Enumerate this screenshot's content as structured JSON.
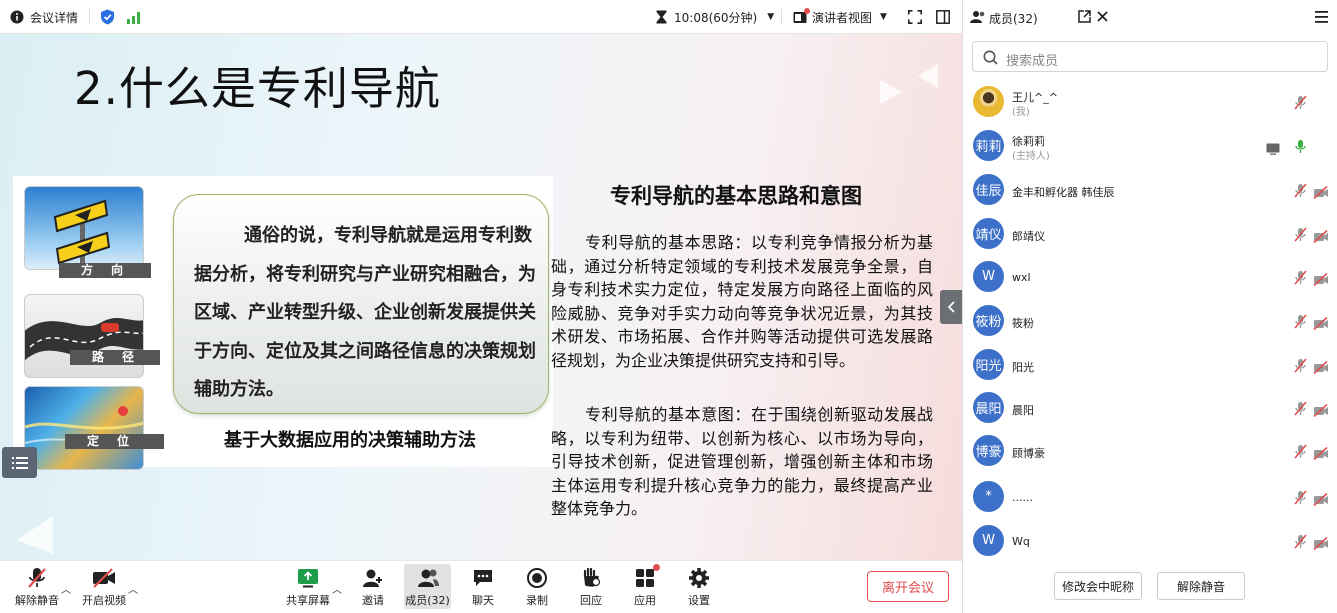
{
  "topbar": {
    "meeting_info": "会议详情",
    "timer": "10:08(60分钟)",
    "view_mode": "演讲者视图"
  },
  "slide": {
    "title": "2.什么是专利导航",
    "thumb_labels": [
      "方向",
      "路径",
      "定位"
    ],
    "bubble_text": "通俗的说，专利导航就是运用专利数据分析，将专利研究与产业研究相融合，为区域、产业转型升级、企业创新发展提供关于方向、定位及其之间路径信息的决策规划辅助方法。",
    "caption": "基于大数据应用的决策辅助方法",
    "right_title": "专利导航的基本思路和意图",
    "para1": "专利导航的基本思路：以专利竞争情报分析为基础，通过分析特定领域的专利技术发展竞争全景，自身专利技术实力定位，特定发展方向路径上面临的风险威胁、竞争对手实力动向等竞争状况近景，为其技术研发、市场拓展、合作并购等活动提供可选发展路径规划，为企业决策提供研究支持和引导。",
    "para2": "专利导航的基本意图：在于围绕创新驱动发展战略，以专利为纽带、以创新为核心、以市场为导向，引导技术创新，促进管理创新，增强创新主体和市场主体运用专利提升核心竞争力的能力，最终提高产业整体竞争力。"
  },
  "panel": {
    "title": "成员(32)",
    "search_placeholder": "搜索成员",
    "members": [
      {
        "avatar": "",
        "name": "王儿^_^",
        "sub": "(我)",
        "mic": "muted",
        "cam": "none"
      },
      {
        "avatar": "莉莉",
        "name": "徐莉莉",
        "sub": "(主持人)",
        "mic": "on",
        "cam": "screen"
      },
      {
        "avatar": "佳辰",
        "name": "金丰和孵化器 韩佳辰",
        "sub": "",
        "mic": "muted",
        "cam": "off"
      },
      {
        "avatar": "靖仪",
        "name": "郎靖仪",
        "sub": "",
        "mic": "muted",
        "cam": "off"
      },
      {
        "avatar": "W",
        "name": "wxl",
        "sub": "",
        "mic": "muted",
        "cam": "off"
      },
      {
        "avatar": "筱粉",
        "name": "筱粉",
        "sub": "",
        "mic": "muted",
        "cam": "off"
      },
      {
        "avatar": "阳光",
        "name": "阳光",
        "sub": "",
        "mic": "muted",
        "cam": "off"
      },
      {
        "avatar": "晨阳",
        "name": "晨阳",
        "sub": "",
        "mic": "muted",
        "cam": "off"
      },
      {
        "avatar": "博豪",
        "name": "顾博豪",
        "sub": "",
        "mic": "muted",
        "cam": "off"
      },
      {
        "avatar": "*",
        "name": "......",
        "sub": "",
        "mic": "muted",
        "cam": "off"
      },
      {
        "avatar": "W",
        "name": "Wq",
        "sub": "",
        "mic": "muted",
        "cam": "off"
      }
    ],
    "rename_button": "修改会中昵称",
    "unmute_all_button": "解除静音"
  },
  "toolbar": {
    "unmute": "解除静音",
    "start_video": "开启视频",
    "share_screen": "共享屏幕",
    "invite": "邀请",
    "members": "成员(32)",
    "chat": "聊天",
    "record": "录制",
    "reactions": "回应",
    "apps": "应用",
    "settings": "设置",
    "leave": "离开会议"
  },
  "colors": {
    "accent": "#3d70c9",
    "danger": "#e24d4d",
    "mic_on": "#3cb043"
  }
}
